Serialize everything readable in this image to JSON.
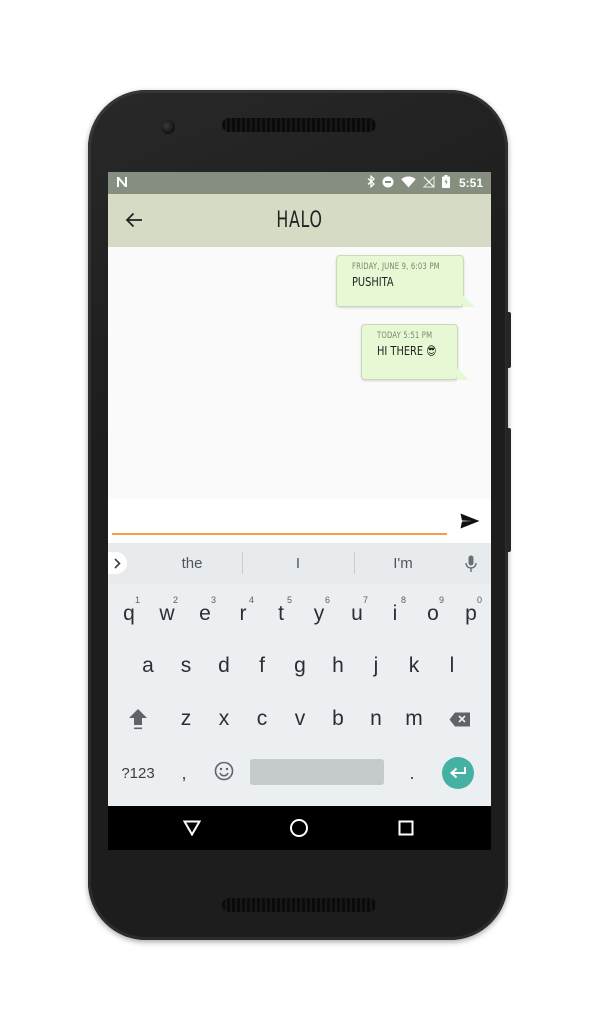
{
  "status_bar": {
    "time": "5:51",
    "icons": [
      "n-logo-icon",
      "bluetooth-icon",
      "do-not-disturb-icon",
      "wifi-icon",
      "no-sim-icon",
      "battery-charging-icon"
    ]
  },
  "app_bar": {
    "title": "HALO",
    "back_icon": "arrow-back-icon"
  },
  "messages": [
    {
      "timestamp": "Friday, June 9, 6:03 PM",
      "text": "PUSHITA"
    },
    {
      "timestamp": "Today 5:51 PM",
      "text": "HI THERE 😎"
    }
  ],
  "composer": {
    "value": "",
    "placeholder": "",
    "send_icon": "send-icon"
  },
  "keyboard": {
    "suggestions": [
      "the",
      "I",
      "I'm"
    ],
    "row1": [
      {
        "key": "q",
        "hint": "1"
      },
      {
        "key": "w",
        "hint": "2"
      },
      {
        "key": "e",
        "hint": "3"
      },
      {
        "key": "r",
        "hint": "4"
      },
      {
        "key": "t",
        "hint": "5"
      },
      {
        "key": "y",
        "hint": "6"
      },
      {
        "key": "u",
        "hint": "7"
      },
      {
        "key": "i",
        "hint": "8"
      },
      {
        "key": "o",
        "hint": "9"
      },
      {
        "key": "p",
        "hint": "0"
      }
    ],
    "row2": [
      "a",
      "s",
      "d",
      "f",
      "g",
      "h",
      "j",
      "k",
      "l"
    ],
    "row3": [
      "z",
      "x",
      "c",
      "v",
      "b",
      "n",
      "m"
    ],
    "symbols_label": "?123",
    "comma_label": ",",
    "period_label": ".",
    "accent_color": "#44b1a3"
  },
  "colors": {
    "status_bar": "#868f7f",
    "app_bar": "#d6dbc6",
    "bubble": "#e6f9d4",
    "input_underline": "#f0a04b"
  }
}
